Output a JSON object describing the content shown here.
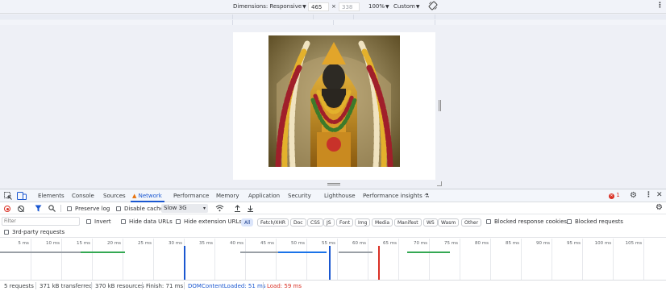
{
  "device_toolbar": {
    "dimensions_label": "Dimensions: Responsive",
    "width": "465",
    "times": "×",
    "height": "338",
    "zoom": "100%",
    "throttle_preset": "Custom"
  },
  "devtools": {
    "tabs": [
      "Elements",
      "Console",
      "Sources",
      "Network",
      "Performance",
      "Memory",
      "Application",
      "Security",
      "Lighthouse",
      "Performance insights"
    ],
    "active_tab": "Network",
    "error_count": "1",
    "controls": {
      "preserve_log": "Preserve log",
      "disable_cache": "Disable cache",
      "throttling": "Slow 3G"
    },
    "filter": {
      "placeholder": "Filter",
      "invert": "Invert",
      "hide_data_urls": "Hide data URLs",
      "hide_extension_urls": "Hide extension URLs",
      "types": [
        "All",
        "Fetch/XHR",
        "Doc",
        "CSS",
        "JS",
        "Font",
        "Img",
        "Media",
        "Manifest",
        "WS",
        "Wasm",
        "Other"
      ],
      "active_type": "All",
      "blocked_response_cookies": "Blocked response cookies",
      "blocked_requests": "Blocked requests",
      "third_party": "3rd-party requests"
    },
    "timeline_ticks": [
      "5 ms",
      "10 ms",
      "15 ms",
      "20 ms",
      "25 ms",
      "30 ms",
      "35 ms",
      "40 ms",
      "45 ms",
      "50 ms",
      "55 ms",
      "60 ms",
      "65 ms",
      "70 ms",
      "75 ms",
      "80 ms",
      "85 ms",
      "90 ms",
      "95 ms",
      "100 ms",
      "105 ms"
    ],
    "status": {
      "requests": "5 requests",
      "transferred": "371 kB transferred",
      "resources": "370 kB resources",
      "finish": "Finish: 71 ms",
      "dom_content_loaded": "DOMContentLoaded: 51 ms",
      "load": "Load: 59 ms"
    }
  },
  "colors": {
    "accent": "#1a57d0",
    "dcl_line": "#1a57d0",
    "load_line": "#d93025",
    "error": "#d93025"
  }
}
